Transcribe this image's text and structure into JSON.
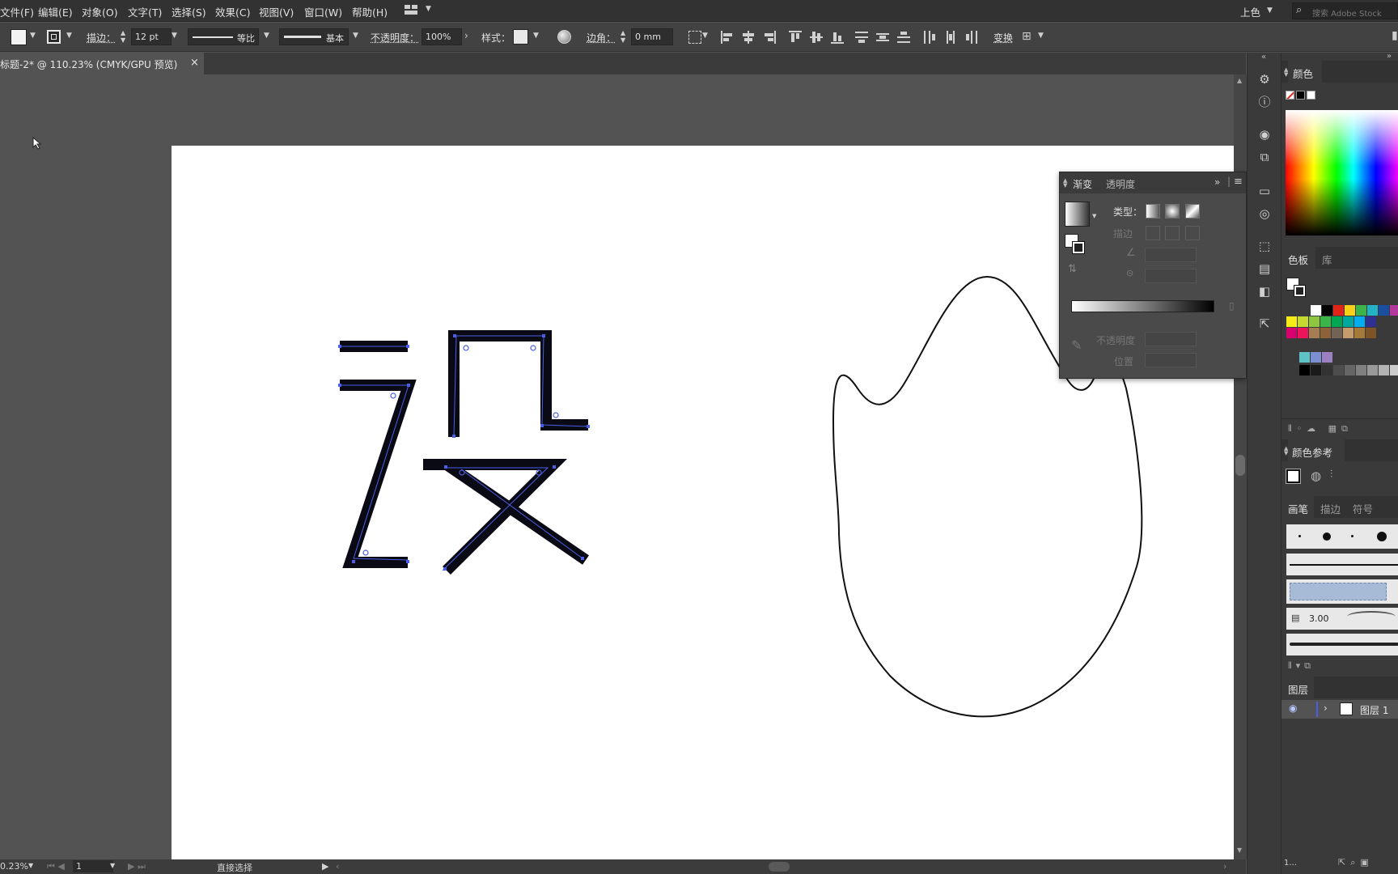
{
  "menu": {
    "file": "文件(F)",
    "edit": "编辑(E)",
    "object": "对象(O)",
    "type": "文字(T)",
    "select": "选择(S)",
    "effect": "效果(C)",
    "view": "视图(V)",
    "window": "窗口(W)",
    "help": "帮助(H)",
    "workspace": "上色",
    "search_placeholder": "搜索 Adobe Stock"
  },
  "control": {
    "stroke_label": "描边：",
    "stroke_weight": "12 pt",
    "profile": "等比",
    "brush": "基本",
    "opacity_label": "不透明度：",
    "opacity_value": "100%",
    "style_label": "样式：",
    "corner_label": "边角：",
    "corner_value": "0 mm",
    "transform_label": "变换"
  },
  "document": {
    "tab_title": "标题-2* @ 110.23% (CMYK/GPU 预览)",
    "close_glyph": "×"
  },
  "status": {
    "zoom": "0.23%",
    "artboard_number": "1",
    "tool": "直接选择"
  },
  "gradient_panel": {
    "tab_gradient": "渐变",
    "tab_transparency": "透明度",
    "type_label": "类型：",
    "stroke_label": "描边",
    "opacity_label": "不透明度",
    "position_label": "位置"
  },
  "panels": {
    "color_tab": "颜色",
    "swatches_tab": "色板",
    "library_tab": "库",
    "color_guide_tab": "颜色参考",
    "brushes_tab": "画笔",
    "stroke_tab": "描边",
    "symbols_tab": "符号",
    "brush_size": "3.00",
    "layers_tab": "图层",
    "layer_name": "图层 1",
    "bottom_count": "1..."
  },
  "colors": {
    "accent_path": "#4a5fe6",
    "artboard": "#ffffff"
  },
  "swatches": {
    "row1": [
      "#ffffff",
      "#000000",
      "#e2231a",
      "#f7d117",
      "#3bb44a",
      "#23b3c4",
      "#1a4ea1",
      "#b3389b"
    ],
    "row2": [
      "#f6eb14",
      "#c6d931",
      "#8ec63f",
      "#39b54a",
      "#00a651",
      "#00a99d",
      "#00aeef",
      "#2e3192"
    ],
    "row3": [
      "#d6006f",
      "#ed145b",
      "#a67c52",
      "#8c6239",
      "#736357",
      "#c69c6d",
      "#a57a3a",
      "#7d5426"
    ],
    "row4": [
      "#5ec3c6",
      "#7d8fd1",
      "#9b7fc1"
    ],
    "grays": [
      "#000000",
      "#1a1a1a",
      "#333333",
      "#4d4d4d",
      "#666666",
      "#808080",
      "#999999",
      "#b3b3b3",
      "#cccccc"
    ]
  }
}
